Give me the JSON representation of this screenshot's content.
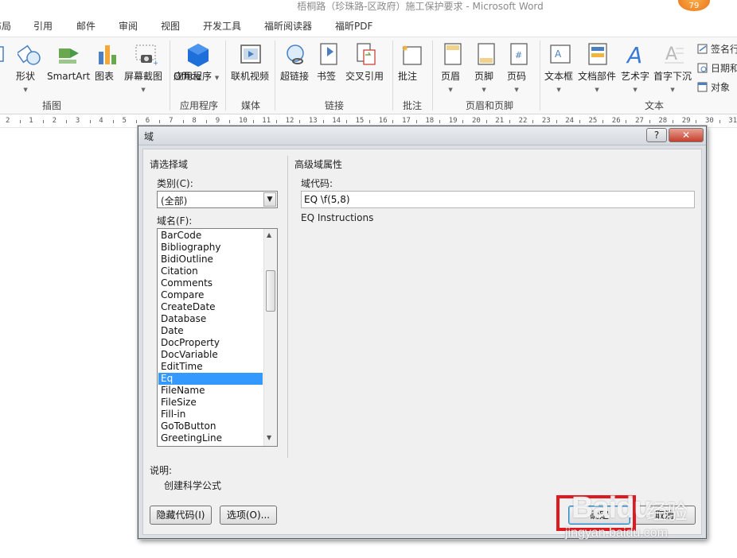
{
  "window": {
    "title": "梧桐路（珍珠路-区政府）施工保护要求 - Microsoft Word"
  },
  "menu_tabs": [
    "布局",
    "引用",
    "邮件",
    "审阅",
    "视图",
    "开发工具",
    "福昕阅读器",
    "福昕PDF"
  ],
  "ribbon": {
    "buttons": {
      "picture": "片",
      "shapes": "形状",
      "smartart": "SmartArt",
      "chart": "图表",
      "screenshot": "屏幕截图",
      "office_apps_1": "Office",
      "office_apps_2": "应用程序",
      "online_video": "联机视频",
      "hyperlink": "超链接",
      "bookmark": "书签",
      "crossref": "交叉引用",
      "comment": "批注",
      "header": "页眉",
      "footer": "页脚",
      "page_number": "页码",
      "textbox": "文本框",
      "quickparts": "文档部件",
      "wordart": "艺术字",
      "dropcap": "首字下沉",
      "signature": "签名行",
      "datetime": "日期和",
      "object": "对象"
    },
    "groups": {
      "illustrations": "插图",
      "apps": "应用程序",
      "media": "媒体",
      "links": "链接",
      "comments": "批注",
      "header_footer": "页眉和页脚",
      "text": "文本"
    },
    "icons": [
      "picture-icon",
      "shapes-icon",
      "smartart-icon",
      "chart-icon",
      "screenshot-icon",
      "office-apps-icon",
      "video-icon",
      "hyperlink-icon",
      "bookmark-icon",
      "crossref-icon",
      "comment-icon",
      "header-icon",
      "footer-icon",
      "page-number-icon",
      "textbox-icon",
      "quickparts-icon",
      "wordart-icon",
      "dropcap-icon",
      "signature-icon",
      "datetime-icon",
      "object-icon"
    ]
  },
  "ruler": {
    "labels": [
      "2",
      "1",
      "2",
      "3",
      "4",
      "5",
      "6",
      "7",
      "8",
      "9",
      "10",
      "11",
      "12",
      "13",
      "14",
      "15",
      "16",
      "17",
      "18",
      "19",
      "20",
      "21",
      "22",
      "23",
      "24",
      "25",
      "26",
      "27",
      "28",
      "29",
      "30",
      "31",
      "32",
      "33"
    ]
  },
  "dialog": {
    "title": "域",
    "help": "?",
    "close": "✕",
    "left": {
      "section": "请选择域",
      "category_label": "类别(C):",
      "category_value": "(全部)",
      "fieldname_label": "域名(F):",
      "fields": [
        "BarCode",
        "Bibliography",
        "BidiOutline",
        "Citation",
        "Comments",
        "Compare",
        "CreateDate",
        "Database",
        "Date",
        "DocProperty",
        "DocVariable",
        "EditTime",
        "Eq",
        "FileName",
        "FileSize",
        "Fill-in",
        "GoToButton",
        "GreetingLine"
      ],
      "selected": "Eq"
    },
    "right": {
      "section": "高级域属性",
      "code_label": "域代码:",
      "code_value": "EQ \\f(5,8)",
      "instructions": "EQ Instructions"
    },
    "description_label": "说明:",
    "description": "创建科学公式",
    "buttons": {
      "hide_codes": "隐藏代码(I)",
      "options": "选项(O)...",
      "ok": "确定",
      "cancel": "取消"
    }
  },
  "watermark": {
    "brand": "Baidu",
    "cn": "经验",
    "url": "jingyan.baidu.com"
  },
  "colors": {
    "selection": "#3399ff",
    "highlight_box": "#e0191f",
    "office_icon": "#1e6fd9"
  }
}
